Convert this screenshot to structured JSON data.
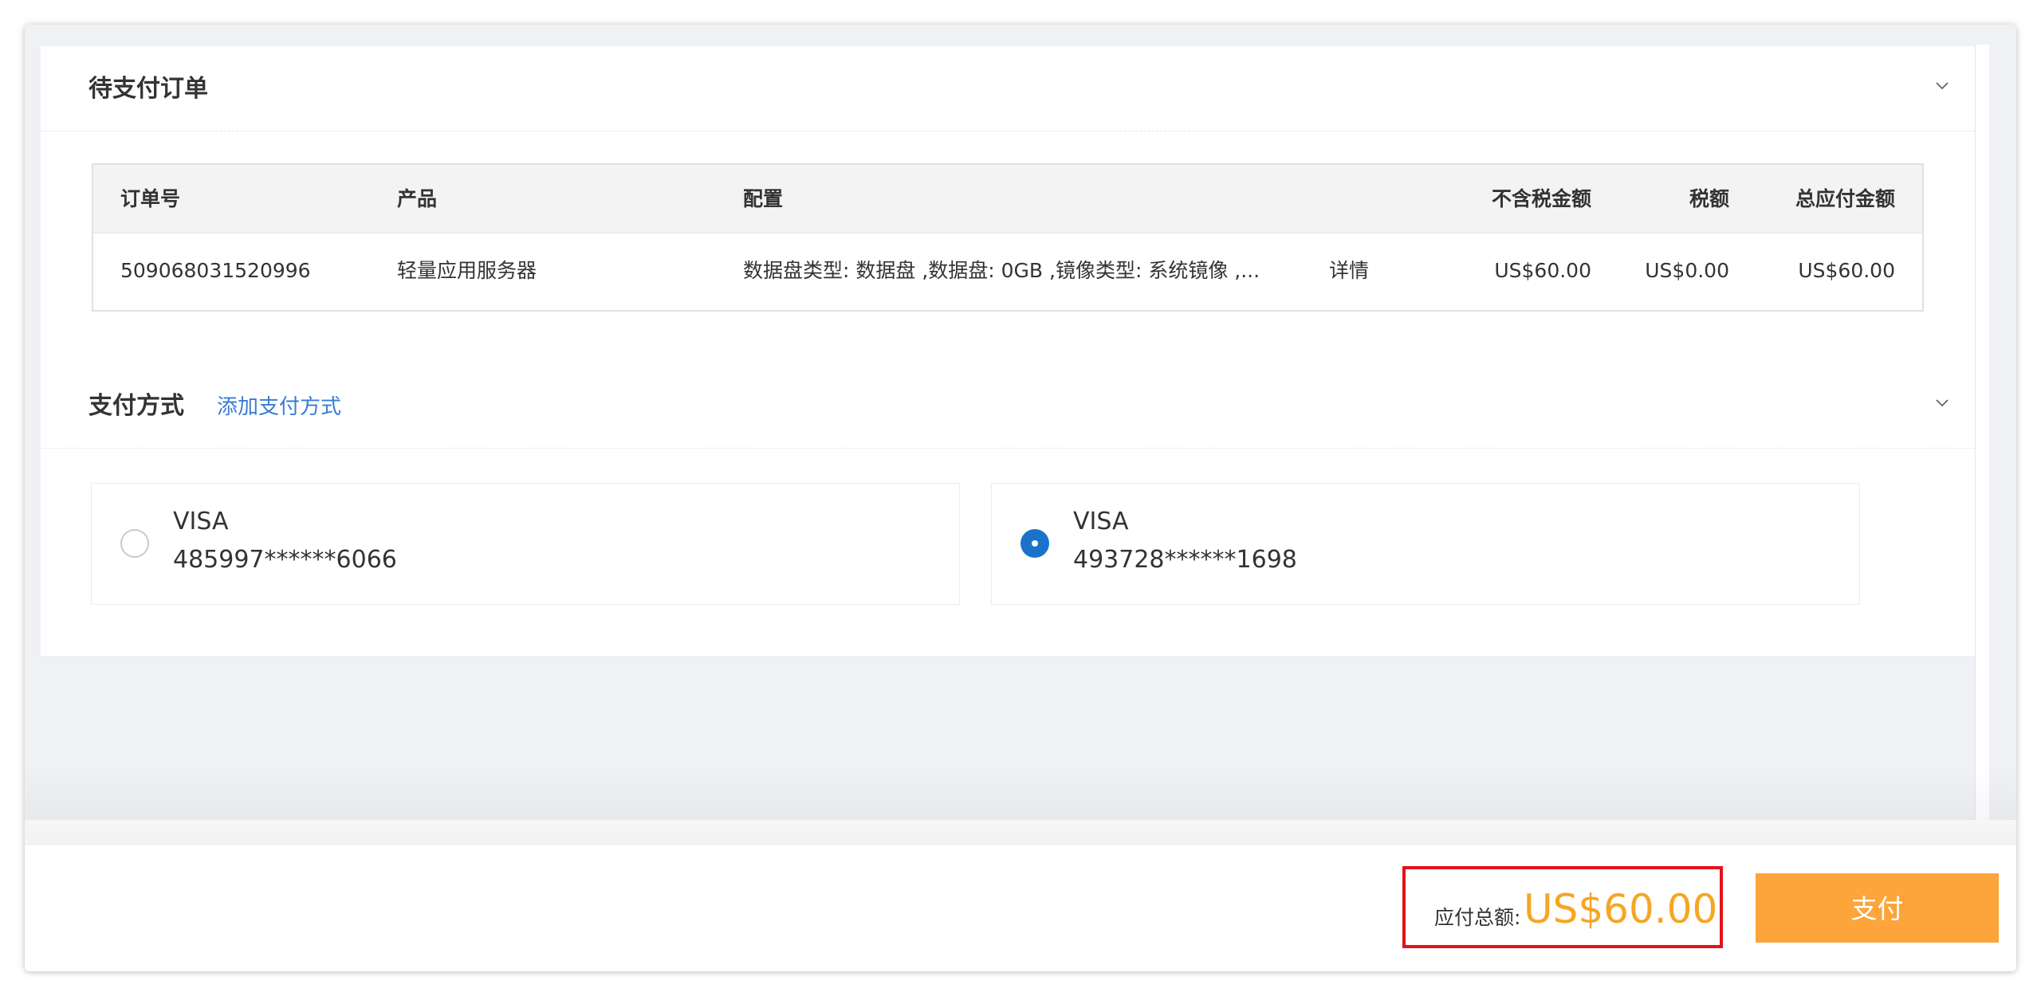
{
  "orders_section": {
    "title": "待支付订单",
    "columns": {
      "order_no": "订单号",
      "product": "产品",
      "config": "配置",
      "pretax": "不含税金额",
      "tax": "税额",
      "total": "总应付金额"
    },
    "rows": [
      {
        "order_no": "509068031520996",
        "product": "轻量应用服务器",
        "config": "数据盘类型: 数据盘 ,数据盘: 0GB ,镜像类型: 系统镜像 ,...",
        "detail_link": "详情",
        "pretax": "US$60.00",
        "tax": "US$0.00",
        "total": "US$60.00"
      }
    ]
  },
  "payment_section": {
    "title": "支付方式",
    "add_link": "添加支付方式",
    "cards": [
      {
        "brand": "VISA",
        "number": "485997******6066",
        "selected": false
      },
      {
        "brand": "VISA",
        "number": "493728******1698",
        "selected": true
      }
    ]
  },
  "footer": {
    "total_label": "应付总额:",
    "total_value": "US$60.00",
    "pay_button": "支付"
  },
  "colors": {
    "accent_orange": "#f5a623",
    "pay_button": "#fda43a",
    "link_blue": "#3a7bd5",
    "radio_selected": "#1a73c9",
    "highlight_border": "#e3121b"
  },
  "icons": {
    "collapse": "chevron-down-icon"
  }
}
